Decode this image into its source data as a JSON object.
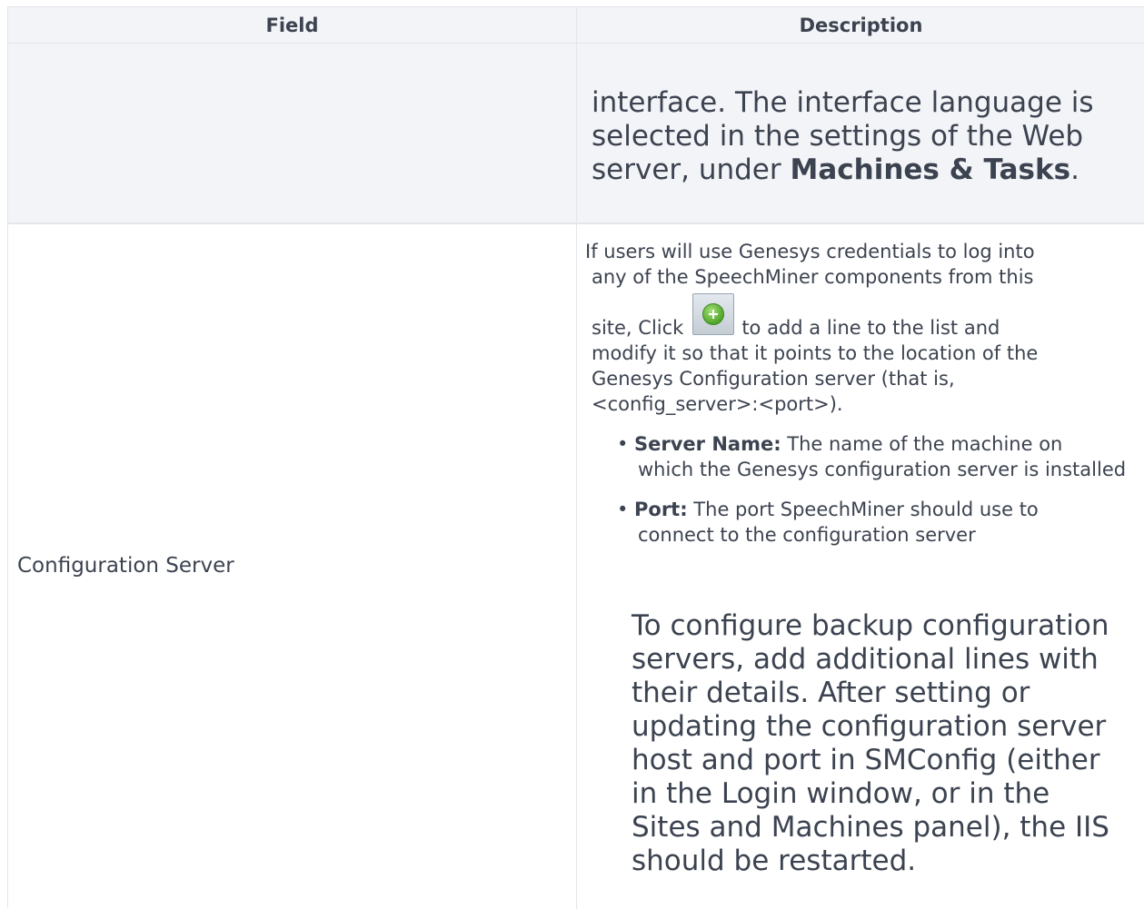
{
  "table": {
    "headers": {
      "field": "Field",
      "description": "Description"
    },
    "row1": {
      "field": "",
      "description_before": "interface. The interface language is selected in the settings of the Web server, under ",
      "description_bold": "Machines & Tasks",
      "description_after": "."
    },
    "row2": {
      "field": "Configuration Server",
      "intro_line1": "If users will use Genesys credentials to log into",
      "intro_line2": "any of the SpeechMiner components from this",
      "intro_line3_before": "site, Click",
      "add_icon": "add-green-plus-icon",
      "intro_line3_after": "to add a line to the list and",
      "intro_line4": "modify it so that it points to the location of the",
      "intro_line5": "Genesys Configuration server (that is,",
      "intro_line6": "<config_server>:<port>).",
      "bullets": [
        {
          "term": "Server Name:",
          "first": " The name of the machine on",
          "rest": "which the Genesys configuration server is installed"
        },
        {
          "term": "Port:",
          "first": " The port SpeechMiner should use to",
          "rest": "connect to the configuration server"
        }
      ],
      "note_lines": [
        "To configure backup configuration",
        "servers, add additional lines with",
        "their details. After setting or",
        "updating the configuration server",
        "host and port in SMConfig (either",
        "in the Login window, or in the",
        "Sites and Machines panel), the IIS",
        "should be restarted."
      ]
    }
  }
}
